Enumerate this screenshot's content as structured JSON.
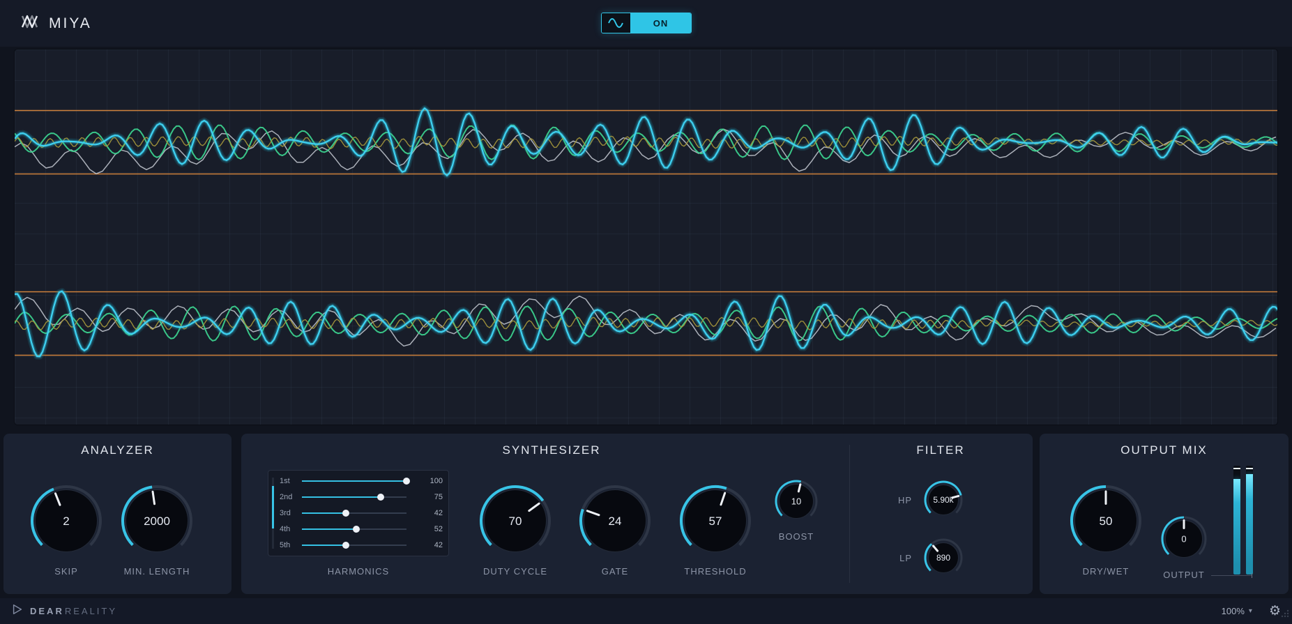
{
  "app": {
    "title": "MIYA",
    "power_state": "ON",
    "accent": "#38c9ec"
  },
  "display": {
    "channels": [
      "channel-1",
      "channel-2"
    ],
    "colors": {
      "threshold": "#d8873c",
      "primary": "#3fd2f2",
      "primary_mid": "#2db4d6",
      "glow": "#177f95",
      "secondary": "#3bd08d",
      "raw": "#c6cad2",
      "aux": "#a89a3c"
    }
  },
  "panels": {
    "analyzer": {
      "title": "ANALYZER",
      "knobs": [
        {
          "id": "skip",
          "label": "SKIP",
          "value": "2",
          "frac": 0.42
        },
        {
          "id": "min_length",
          "label": "MIN. LENGTH",
          "value": "2000",
          "frac": 0.47
        }
      ]
    },
    "synthesizer": {
      "title": "SYNTHESIZER",
      "harmonics": {
        "label": "HARMONICS",
        "max": 100,
        "rows": [
          {
            "name": "1st",
            "value": 100
          },
          {
            "name": "2nd",
            "value": 75
          },
          {
            "name": "3rd",
            "value": 42
          },
          {
            "name": "4th",
            "value": 52
          },
          {
            "name": "5th",
            "value": 42
          }
        ]
      },
      "knobs": [
        {
          "id": "duty_cycle",
          "label": "DUTY CYCLE",
          "value": "70",
          "frac": 0.7
        },
        {
          "id": "gate",
          "label": "GATE",
          "value": "24",
          "frac": 0.24
        },
        {
          "id": "threshold",
          "label": "THRESHOLD",
          "value": "57",
          "frac": 0.57
        },
        {
          "id": "boost",
          "label": "BOOST",
          "value": "10",
          "frac": 0.55
        }
      ]
    },
    "filter": {
      "title": "FILTER",
      "knobs": [
        {
          "id": "hp",
          "label": "HP",
          "value": "5.90k",
          "frac": 0.78
        },
        {
          "id": "lp",
          "label": "LP",
          "value": "890",
          "frac": 0.35
        }
      ]
    },
    "output_mix": {
      "title": "OUTPUT MIX",
      "knobs": [
        {
          "id": "dry_wet",
          "label": "DRY/WET",
          "value": "50",
          "frac": 0.5
        },
        {
          "id": "output",
          "label": "OUTPUT",
          "value": "0",
          "frac": 0.5
        }
      ],
      "meters": [
        {
          "level": 88,
          "peak": 97
        },
        {
          "level": 92,
          "peak": 97
        }
      ]
    }
  },
  "statusbar": {
    "brand_bold": "DEAR",
    "brand_light": "REALITY",
    "zoom": "100%"
  }
}
